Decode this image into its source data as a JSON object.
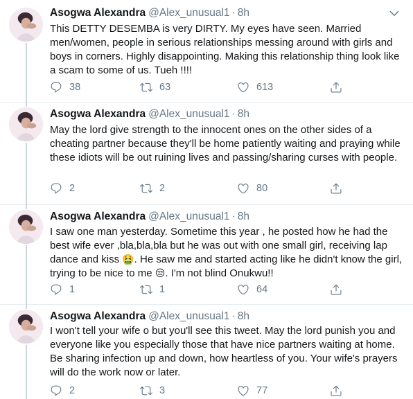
{
  "tweets": [
    {
      "name": "Asogwa Alexandra",
      "handle": "@Alex_unusual1",
      "time": "8h",
      "text": "This DETTY DESEMBA is very DIRTY. My eyes have seen. Married men/women, people in serious relationships messing around with girls and boys in corners. Highly disappointing. Making this relationship thing look like a scam to some of us. Tueh !!!!",
      "replies": "38",
      "retweets": "63",
      "likes": "613"
    },
    {
      "name": "Asogwa Alexandra",
      "handle": "@Alex_unusual1",
      "time": "8h",
      "text": "May the lord give strength to the innocent ones on the other sides of a cheating partner because they'll be home patiently waiting and praying while these idiots will be out ruining lives and passing/sharing curses with people.",
      "replies": "2",
      "retweets": "2",
      "likes": "80"
    },
    {
      "name": "Asogwa Alexandra",
      "handle": "@Alex_unusual1",
      "time": "8h",
      "text_a": "I saw one man yesterday. Sometime this year , he posted how he had the best wife ever ,bla,bla,bla but he was out with one small girl, receiving lap dance and kiss ",
      "emoji_a": "🤮",
      "text_b": ". He saw me and started acting like he didn't know the girl, trying to be nice to me ",
      "emoji_b": "😒",
      "text_c": ". I'm not blind Onukwu!!",
      "replies": "1",
      "retweets": "1",
      "likes": "64"
    },
    {
      "name": "Asogwa Alexandra",
      "handle": "@Alex_unusual1",
      "time": "8h",
      "text": "I won't tell your wife o but you'll see this tweet. May the lord punish you and everyone like you especially those that have nice partners waiting at home. Be sharing infection up and down, how heartless of you. Your wife's prayers will do the work now or later.",
      "replies": "2",
      "retweets": "3",
      "likes": "77"
    }
  ],
  "colors": {
    "text": "#14171a",
    "secondary": "#657786",
    "divider": "#e6ecf0",
    "thread": "#ccd6dd"
  },
  "icons": [
    "chevron-down-icon",
    "reply-icon",
    "retweet-icon",
    "like-icon",
    "share-icon"
  ]
}
